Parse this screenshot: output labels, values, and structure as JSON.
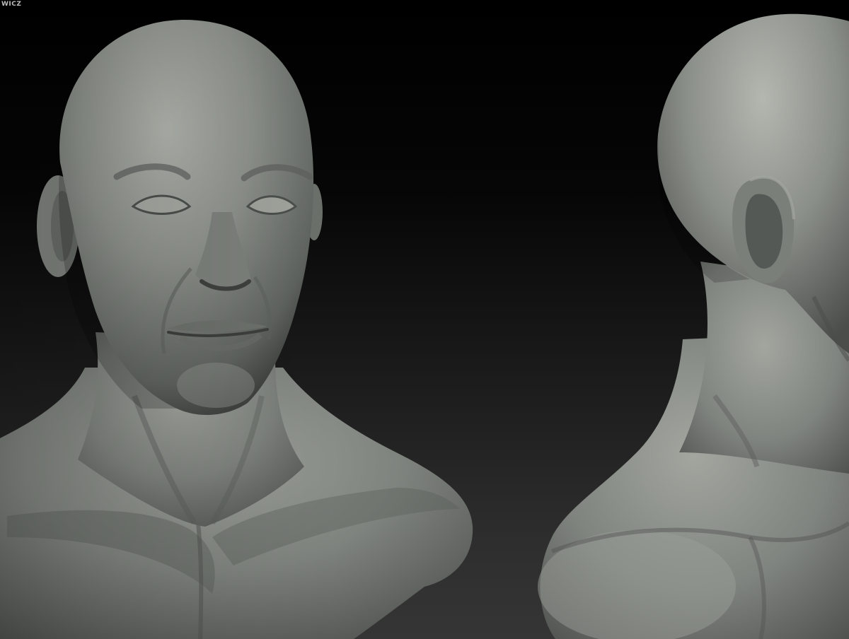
{
  "watermark": {
    "text": "WICZ"
  },
  "render": {
    "subject": "sculpt-bust",
    "views": [
      {
        "name": "front-three-quarter-view"
      },
      {
        "name": "rear-three-quarter-view"
      }
    ]
  },
  "colors": {
    "background_top": "#000000",
    "background_bottom": "#353535",
    "clay_light": "#a3a7a0",
    "clay_mid": "#7b7f7a",
    "clay_dark": "#3f423f"
  }
}
